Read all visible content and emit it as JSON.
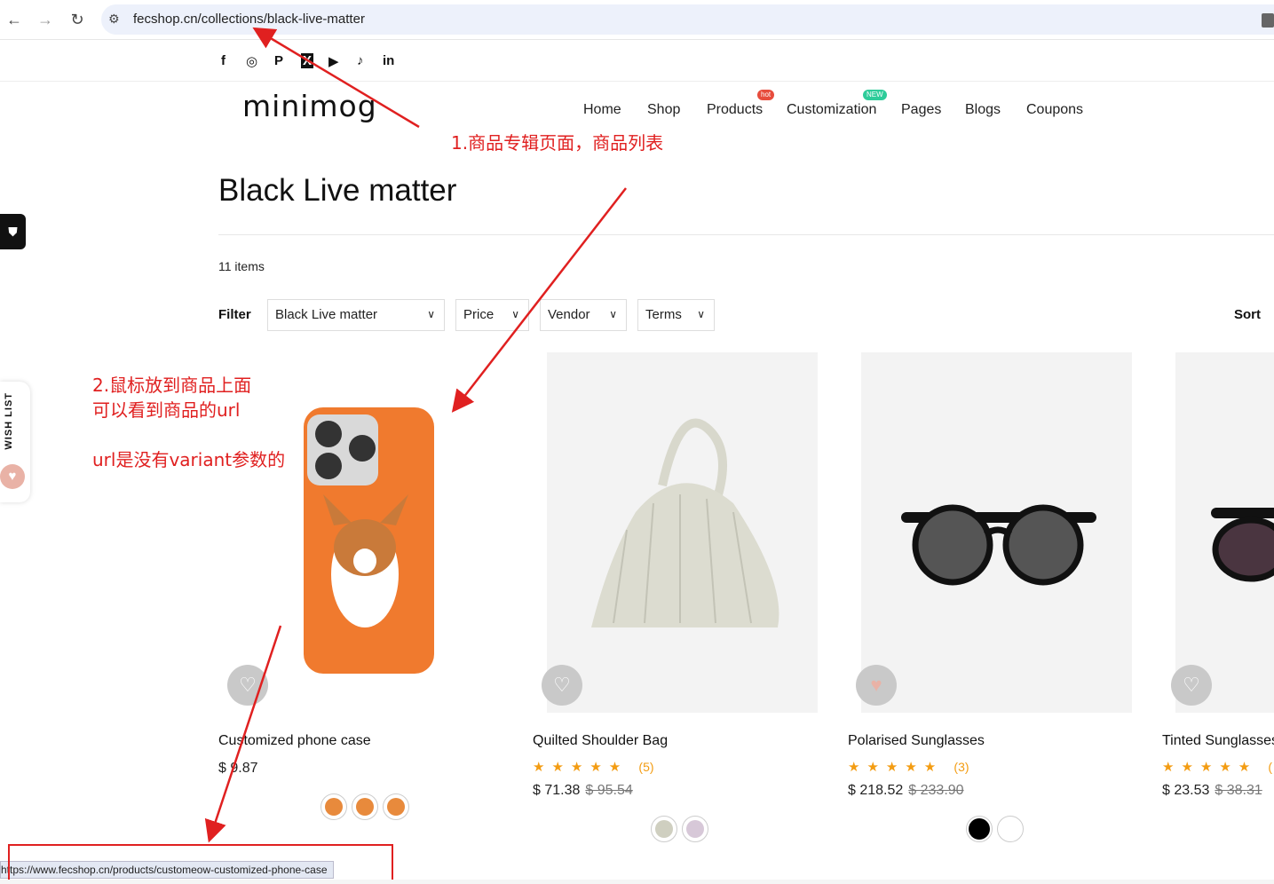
{
  "browser": {
    "back": "←",
    "forward": "→",
    "reload": "↻",
    "site_info_icon": "⚙",
    "url": "fecshop.cn/collections/black-live-matter"
  },
  "social": [
    "f",
    "◎",
    "P",
    "X",
    "▶",
    "♪",
    "in"
  ],
  "header": {
    "logo": "minimog",
    "menu": [
      "Home",
      "Shop",
      "Products",
      "Customization",
      "Pages",
      "Blogs",
      "Coupons"
    ],
    "badge_hot": "hot",
    "badge_new": "NEW"
  },
  "annotations": {
    "note1": "1.商品专辑页面，商品列表",
    "note2_line1": "2.鼠标放到商品上面",
    "note2_line2": "可以看到商品的url",
    "note2_line3": "url是没有variant参数的"
  },
  "collection": {
    "title": "Black Live matter",
    "item_count": "11 items",
    "filter_label": "Filter",
    "filters": [
      "Black Live matter",
      "Price",
      "Vendor",
      "Terms"
    ],
    "sort_label": "Sort"
  },
  "side": {
    "wishlist_label": "WISH LIST"
  },
  "products": [
    {
      "title": "Customized phone case",
      "price": "$ 9.87",
      "old_price": "",
      "stars": "",
      "reviews": ""
    },
    {
      "title": "Quilted Shoulder Bag",
      "price": "$ 71.38",
      "old_price": "$ 95.54",
      "stars": "★★★★★",
      "reviews": "(5)"
    },
    {
      "title": "Polarised Sunglasses",
      "price": "$ 218.52",
      "old_price": "$ 233.90",
      "stars": "★★★★★",
      "reviews": "(3)"
    },
    {
      "title": "Tinted Sunglasses",
      "price": "$ 23.53",
      "old_price": "$ 38.31",
      "stars": "★★★★★",
      "reviews": "("
    }
  ],
  "status_bar_url": "https://www.fecshop.cn/products/customeow-customized-phone-case",
  "colors": {
    "annotation": "#e02020",
    "star": "#f39c12",
    "badge_hot": "#e74c3c",
    "badge_new": "#2ecc9a"
  }
}
